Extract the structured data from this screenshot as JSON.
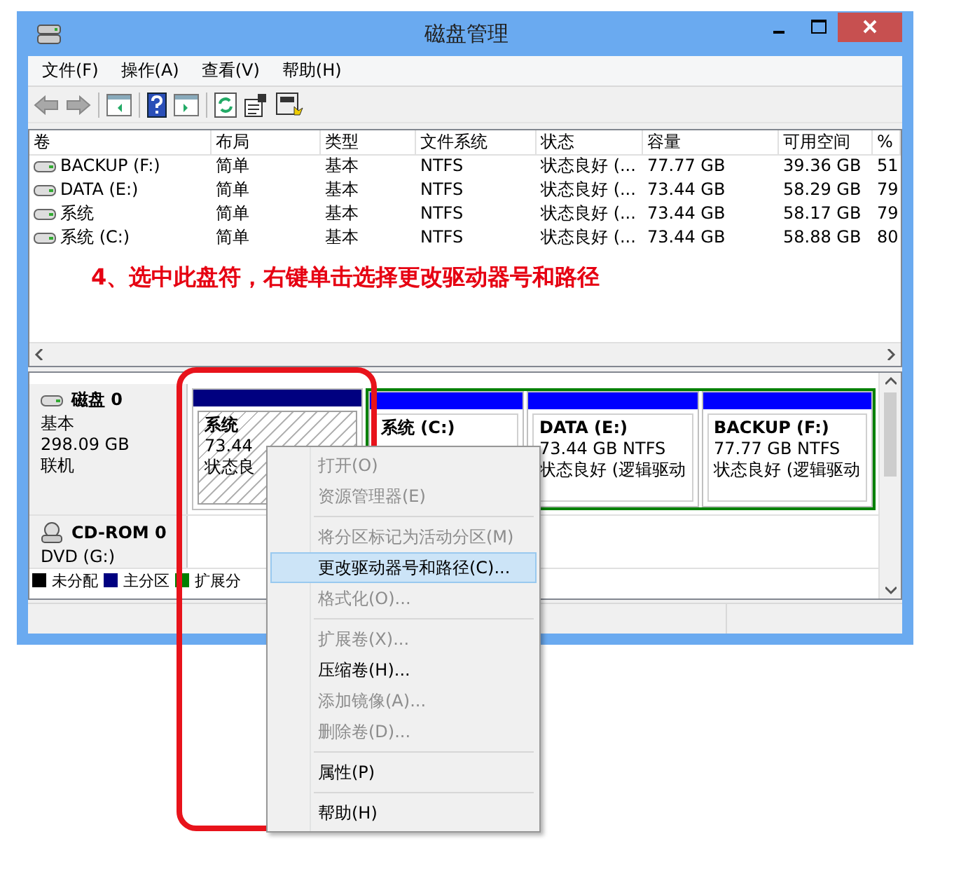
{
  "window": {
    "title": "磁盘管理"
  },
  "menu_bar": [
    "文件(F)",
    "操作(A)",
    "查看(V)",
    "帮助(H)"
  ],
  "toolbar": [
    {
      "kind": "back",
      "disabled": true
    },
    {
      "kind": "forward",
      "disabled": true
    },
    {
      "kind": "sep"
    },
    {
      "kind": "pane"
    },
    {
      "kind": "sep"
    },
    {
      "kind": "help"
    },
    {
      "kind": "pane2"
    },
    {
      "kind": "sep"
    },
    {
      "kind": "refresh"
    },
    {
      "kind": "props"
    },
    {
      "kind": "console"
    }
  ],
  "volume_table": {
    "columns": [
      "卷",
      "布局",
      "类型",
      "文件系统",
      "状态",
      "容量",
      "可用空间",
      "%"
    ],
    "rows": [
      {
        "cells": [
          "BACKUP (F:)",
          "简单",
          "基本",
          "NTFS",
          "状态良好 (...",
          "77.77 GB",
          "39.36 GB",
          "51"
        ]
      },
      {
        "cells": [
          "DATA (E:)",
          "简单",
          "基本",
          "NTFS",
          "状态良好 (...",
          "73.44 GB",
          "58.29 GB",
          "79"
        ]
      },
      {
        "cells": [
          "系统",
          "简单",
          "基本",
          "NTFS",
          "状态良好 (...",
          "73.44 GB",
          "58.17 GB",
          "79"
        ]
      },
      {
        "cells": [
          "系统 (C:)",
          "简单",
          "基本",
          "NTFS",
          "状态良好 (...",
          "73.44 GB",
          "58.88 GB",
          "80"
        ]
      }
    ]
  },
  "annotation": "4、选中此盘符，右键单击选择更改驱动器号和路径",
  "disks": [
    {
      "kind": "hdd",
      "name": "磁盘 0",
      "lines": [
        "基本",
        "298.09 GB",
        "联机"
      ],
      "partitions": [
        {
          "kind": "primary",
          "selected": true,
          "title": "系统",
          "lines": [
            "73.44",
            "状态良"
          ]
        },
        {
          "kind": "logical",
          "selected": false,
          "title": "系统 (C:)"
        },
        {
          "kind": "logical",
          "selected": false,
          "title": "DATA (E:)",
          "lines": [
            "73.44 GB NTFS",
            "状态良好 (逻辑驱动"
          ]
        },
        {
          "kind": "logical",
          "selected": false,
          "title": "BACKUP (F:)",
          "lines": [
            "77.77 GB NTFS",
            "状态良好 (逻辑驱动"
          ]
        }
      ]
    },
    {
      "kind": "cdrom",
      "name": "CD-ROM 0",
      "lines": [
        "DVD (G:)"
      ]
    }
  ],
  "legend": [
    {
      "label": "未分配",
      "color": "#000000"
    },
    {
      "label": "主分区",
      "color": "#000080"
    },
    {
      "label": "扩展分",
      "color": "#008000"
    }
  ],
  "context_menu": [
    {
      "kind": "item",
      "label": "打开(O)",
      "disabled": true,
      "selected": false
    },
    {
      "kind": "item",
      "label": "资源管理器(E)",
      "disabled": true,
      "selected": false
    },
    {
      "kind": "separator"
    },
    {
      "kind": "item",
      "label": "将分区标记为活动分区(M)",
      "disabled": true,
      "selected": false
    },
    {
      "kind": "item",
      "label": "更改驱动器号和路径(C)...",
      "disabled": false,
      "selected": true
    },
    {
      "kind": "item",
      "label": "格式化(O)...",
      "disabled": true,
      "selected": false
    },
    {
      "kind": "separator"
    },
    {
      "kind": "item",
      "label": "扩展卷(X)...",
      "disabled": true,
      "selected": false
    },
    {
      "kind": "item",
      "label": "压缩卷(H)...",
      "disabled": false,
      "selected": false
    },
    {
      "kind": "item",
      "label": "添加镜像(A)...",
      "disabled": true,
      "selected": false
    },
    {
      "kind": "item",
      "label": "删除卷(D)...",
      "disabled": true,
      "selected": false
    },
    {
      "kind": "separator"
    },
    {
      "kind": "item",
      "label": "属性(P)",
      "disabled": false,
      "selected": false
    },
    {
      "kind": "separator"
    },
    {
      "kind": "item",
      "label": "帮助(H)",
      "disabled": false,
      "selected": false
    }
  ]
}
